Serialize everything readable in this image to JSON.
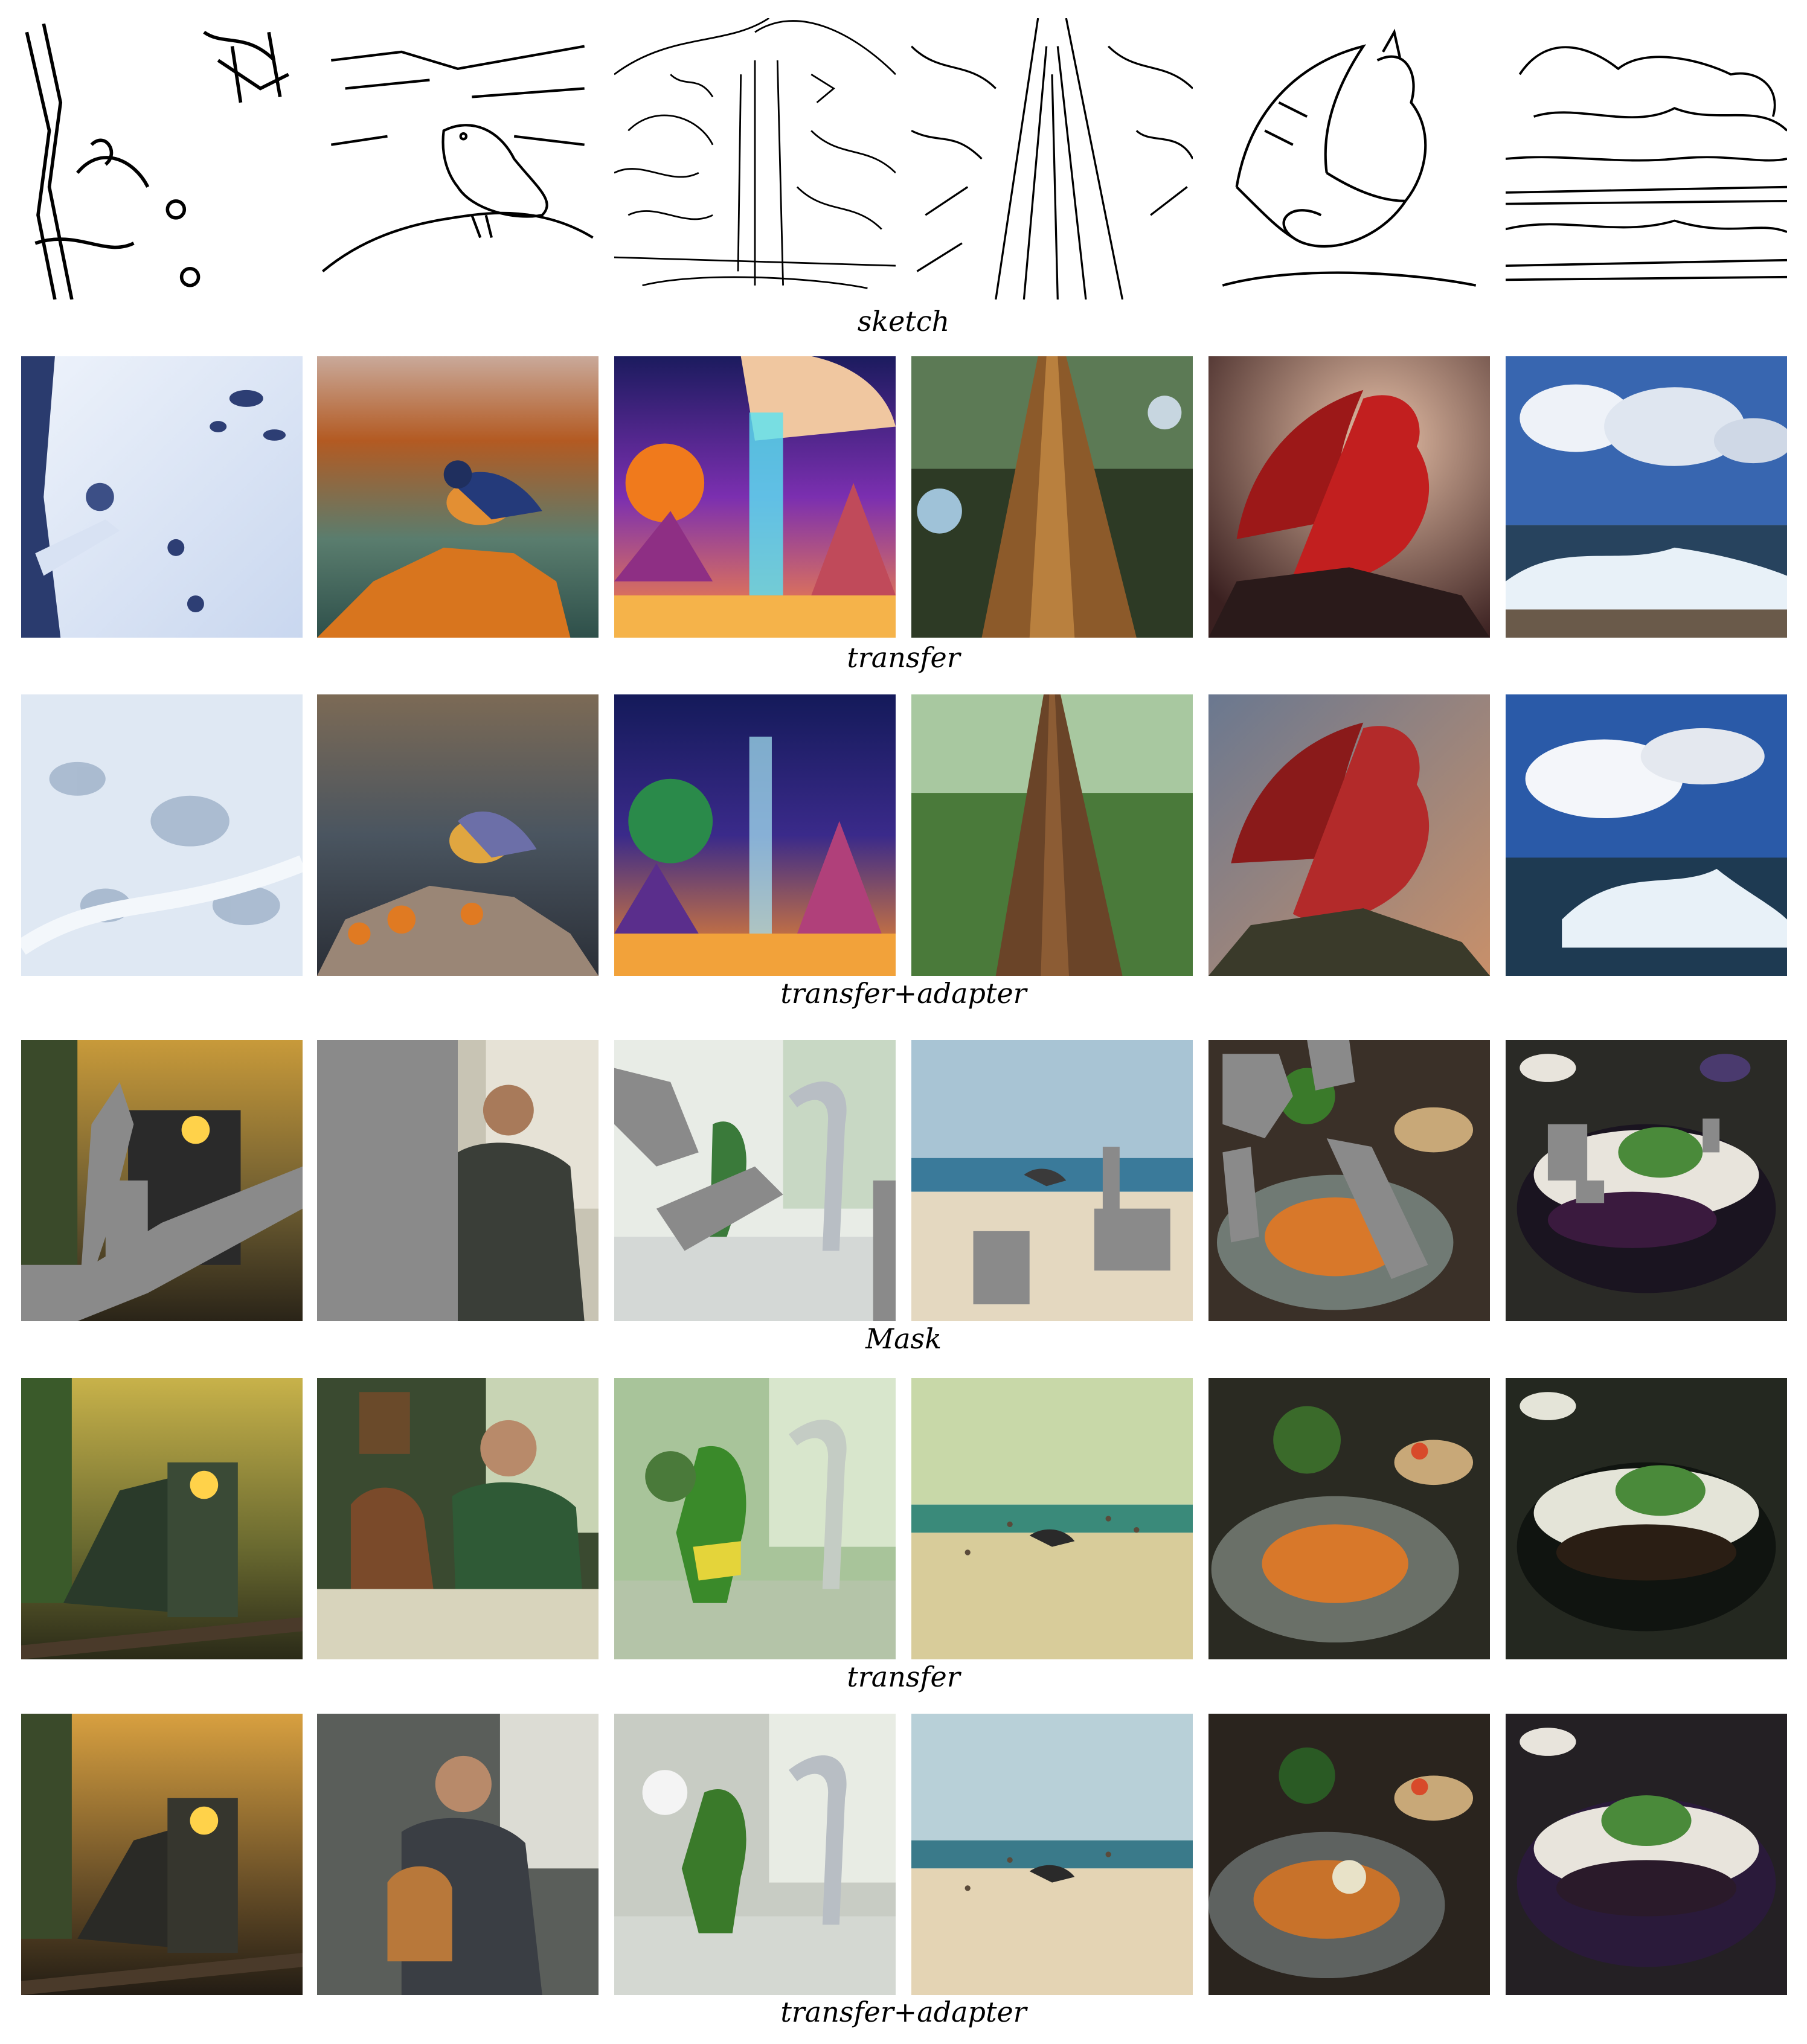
{
  "captions": {
    "sketch": "sketch",
    "transfer_1": "transfer",
    "adapter_1": "transfer+adapter",
    "mask": "Mask",
    "transfer_2": "transfer",
    "adapter_2": "transfer+adapter"
  },
  "columns": {
    "group1": [
      "snow",
      "bird",
      "fantasy-waterfall",
      "tree-trunk",
      "red-dragon",
      "ocean-clouds"
    ],
    "group2": [
      "train",
      "man-and-dog",
      "dinosaur-toy",
      "beach-bird",
      "food-plate",
      "rice-bowl"
    ]
  },
  "colors": {
    "mask_gray": "#8a8a8a",
    "sketch_line": "#000000"
  }
}
